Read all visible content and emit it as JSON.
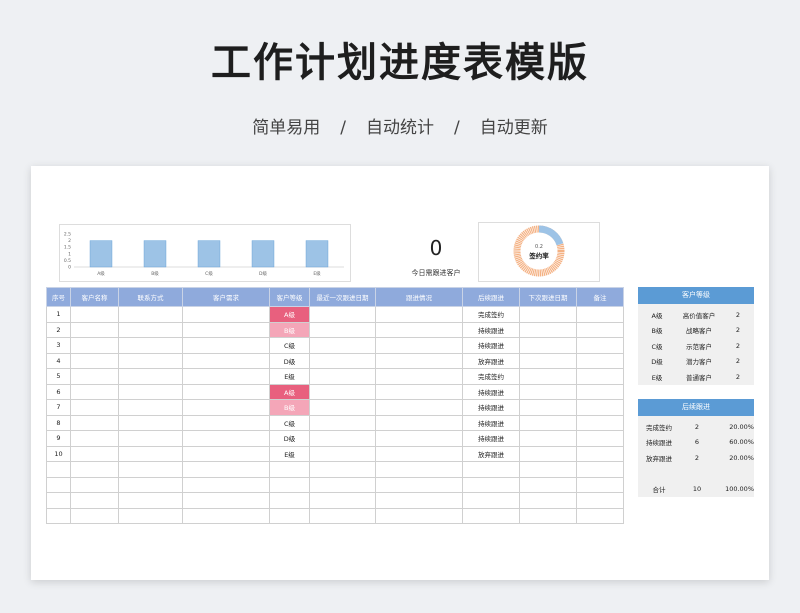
{
  "header": {
    "title": "工作计划进度表模版",
    "subtitle_items": [
      "简单易用",
      "/",
      "自动统计",
      "/",
      "自动更新"
    ]
  },
  "bar_chart": {
    "y_ticks": [
      "2.5",
      "2",
      "1.5",
      "1",
      "0.5",
      "0"
    ],
    "categories": [
      "A级",
      "B级",
      "C级",
      "D级",
      "E级"
    ],
    "values": [
      2,
      2,
      2,
      2,
      2
    ],
    "ylim": [
      0,
      2.5
    ],
    "bar_color": "#9dc3e6"
  },
  "today_followup": {
    "value": "0",
    "label": "今日需跟进客户"
  },
  "donut": {
    "label": "签约率",
    "value_text": "0.2",
    "value": 0.2,
    "colors": {
      "signed": "#9dc3e6",
      "rest": "#f4b183"
    }
  },
  "main_table": {
    "headers": [
      "序号",
      "客户名称",
      "联系方式",
      "客户需求",
      "客户等级",
      "最近一次跟进日期",
      "跟进情况",
      "后续跟进",
      "下次跟进日期",
      "备注"
    ],
    "rows": [
      [
        "1",
        "",
        "",
        "",
        "A级",
        "",
        "",
        "完成签约",
        "",
        ""
      ],
      [
        "2",
        "",
        "",
        "",
        "B级",
        "",
        "",
        "持续跟进",
        "",
        ""
      ],
      [
        "3",
        "",
        "",
        "",
        "C级",
        "",
        "",
        "持续跟进",
        "",
        ""
      ],
      [
        "4",
        "",
        "",
        "",
        "D级",
        "",
        "",
        "放弃跟进",
        "",
        ""
      ],
      [
        "5",
        "",
        "",
        "",
        "E级",
        "",
        "",
        "完成签约",
        "",
        ""
      ],
      [
        "6",
        "",
        "",
        "",
        "A级",
        "",
        "",
        "持续跟进",
        "",
        ""
      ],
      [
        "7",
        "",
        "",
        "",
        "B级",
        "",
        "",
        "持续跟进",
        "",
        ""
      ],
      [
        "8",
        "",
        "",
        "",
        "C级",
        "",
        "",
        "持续跟进",
        "",
        ""
      ],
      [
        "9",
        "",
        "",
        "",
        "D级",
        "",
        "",
        "持续跟进",
        "",
        ""
      ],
      [
        "10",
        "",
        "",
        "",
        "E级",
        "",
        "",
        "放弃跟进",
        "",
        ""
      ],
      [
        "",
        "",
        "",
        "",
        "",
        "",
        "",
        "",
        "",
        ""
      ],
      [
        "",
        "",
        "",
        "",
        "",
        "",
        "",
        "",
        "",
        ""
      ],
      [
        "",
        "",
        "",
        "",
        "",
        "",
        "",
        "",
        "",
        ""
      ],
      [
        "",
        "",
        "",
        "",
        "",
        "",
        "",
        "",
        "",
        ""
      ]
    ]
  },
  "grade_table": {
    "title": "客户等级",
    "rows": [
      [
        "A级",
        "高价值客户",
        "2"
      ],
      [
        "B级",
        "战略客户",
        "2"
      ],
      [
        "C级",
        "示范客户",
        "2"
      ],
      [
        "D级",
        "潜力客户",
        "2"
      ],
      [
        "E级",
        "普通客户",
        "2"
      ]
    ]
  },
  "followup_table": {
    "title": "后续跟进",
    "rows": [
      [
        "完成签约",
        "2",
        "20.00%"
      ],
      [
        "持续跟进",
        "6",
        "60.00%"
      ],
      [
        "放弃跟进",
        "2",
        "20.00%"
      ],
      [
        "",
        "",
        ""
      ],
      [
        "合计",
        "10",
        "100.00%"
      ]
    ]
  }
}
